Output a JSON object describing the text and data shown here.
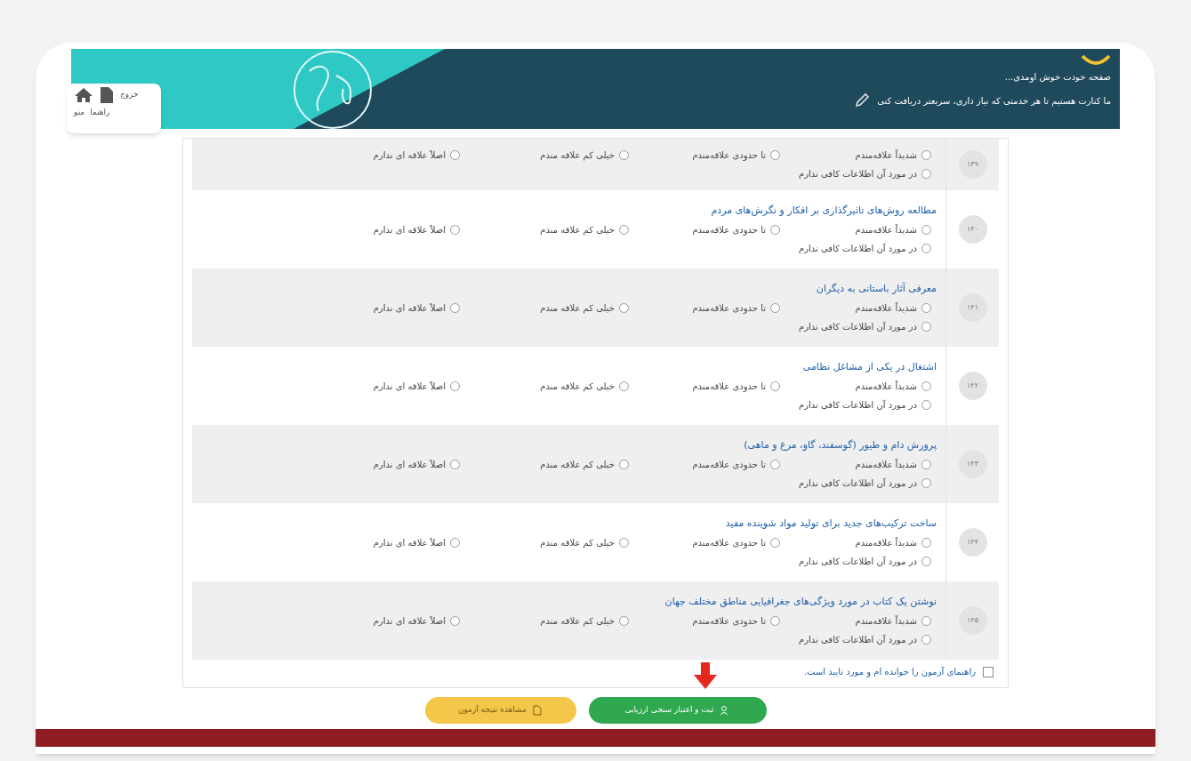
{
  "header": {
    "greeting": "صفحه خودت خوش اومدی...",
    "tagline": "ما کنارت هستیم تا هر خدمتی که نیاز داری، سریعتر دریافت کنی"
  },
  "nav": {
    "exit": "خروج",
    "labels": [
      "راهنما",
      "منو"
    ]
  },
  "questions": [
    {
      "number": "۱۳۹",
      "options": [
        {
          "label": "شدیداً علاقه‌مندم",
          "selected": false
        },
        {
          "label": "تا حدودی علاقه‌مندم",
          "selected": false
        },
        {
          "label": "خیلی کم علاقه مندم",
          "selected": false
        },
        {
          "label": "اصلاً علاقه ای ندارم",
          "selected": false
        },
        {
          "label": "در مورد آن اطلاعات کافی ندارم",
          "selected": false
        }
      ]
    },
    {
      "number": "۱۴۰",
      "title": "مطالعه روش‌های تاثیرگذاری بر افکار و نگرش‌های مردم",
      "options": [
        {
          "label": "شدیداً علاقه‌مندم",
          "selected": false
        },
        {
          "label": "تا حدودی علاقه‌مندم",
          "selected": false
        },
        {
          "label": "خیلی کم علاقه مندم",
          "selected": false
        },
        {
          "label": "اصلاً علاقه ای ندارم",
          "selected": false
        },
        {
          "label": "در مورد آن اطلاعات کافی ندارم",
          "selected": false
        }
      ]
    },
    {
      "number": "۱۴۱",
      "title": "معرفی آثار باستانی به دیگران",
      "options": [
        {
          "label": "شدیداً علاقه‌مندم",
          "selected": false
        },
        {
          "label": "تا حدودی علاقه‌مندم",
          "selected": false
        },
        {
          "label": "خیلی کم علاقه مندم",
          "selected": false
        },
        {
          "label": "اصلاً علاقه ای ندارم",
          "selected": false
        },
        {
          "label": "در مورد آن اطلاعات کافی ندارم",
          "selected": false
        }
      ]
    },
    {
      "number": "۱۴۲",
      "title": "اشتغال در یکی از مشاغل نظامی",
      "options": [
        {
          "label": "شدیداً علاقه‌مندم",
          "selected": false
        },
        {
          "label": "تا حدودی علاقه‌مندم",
          "selected": false
        },
        {
          "label": "خیلی کم علاقه مندم",
          "selected": false
        },
        {
          "label": "اصلاً علاقه ای ندارم",
          "selected": false
        },
        {
          "label": "در مورد آن اطلاعات کافی ندارم",
          "selected": false
        }
      ]
    },
    {
      "number": "۱۴۳",
      "title": "پرورش دام و طیور (گوسفند، گاو، مرغ و ماهی)",
      "options": [
        {
          "label": "شدیداً علاقه‌مندم",
          "selected": false
        },
        {
          "label": "تا حدودی علاقه‌مندم",
          "selected": false
        },
        {
          "label": "خیلی کم علاقه مندم",
          "selected": false
        },
        {
          "label": "اصلاً علاقه ای ندارم",
          "selected": false
        },
        {
          "label": "در مورد آن اطلاعات کافی ندارم",
          "selected": false
        }
      ]
    },
    {
      "number": "۱۴۴",
      "title": "ساخت ترکیب‌های جدید برای تولید مواد شوینده مفید",
      "options": [
        {
          "label": "شدیداً علاقه‌مندم",
          "selected": false
        },
        {
          "label": "تا حدودی علاقه‌مندم",
          "selected": false
        },
        {
          "label": "خیلی کم علاقه مندم",
          "selected": false
        },
        {
          "label": "اصلاً علاقه ای ندارم",
          "selected": false
        },
        {
          "label": "در مورد آن اطلاعات کافی ندارم",
          "selected": false
        }
      ]
    },
    {
      "number": "۱۴۵",
      "title": "نوشتن یک کتاب در مورد ویژگی‌های جغرافیایی مناطق مختلف جهان",
      "options": [
        {
          "label": "شدیداً علاقه‌مندم",
          "selected": false
        },
        {
          "label": "تا حدودی علاقه‌مندم",
          "selected": false
        },
        {
          "label": "خیلی کم علاقه مندم",
          "selected": false
        },
        {
          "label": "اصلاً علاقه ای ندارم",
          "selected": false
        },
        {
          "label": "در مورد آن اطلاعات کافی ندارم",
          "selected": false
        }
      ]
    }
  ],
  "agreement": {
    "label": "راهنمای آزمون را خوانده ام و مورد تایید است.",
    "checked": false
  },
  "buttons": [
    {
      "kind": "submit",
      "label": "ثبت و اعتبار سنجی ارزیابی"
    },
    {
      "kind": "result",
      "label": "مشاهده نتیجه آزمون"
    }
  ]
}
